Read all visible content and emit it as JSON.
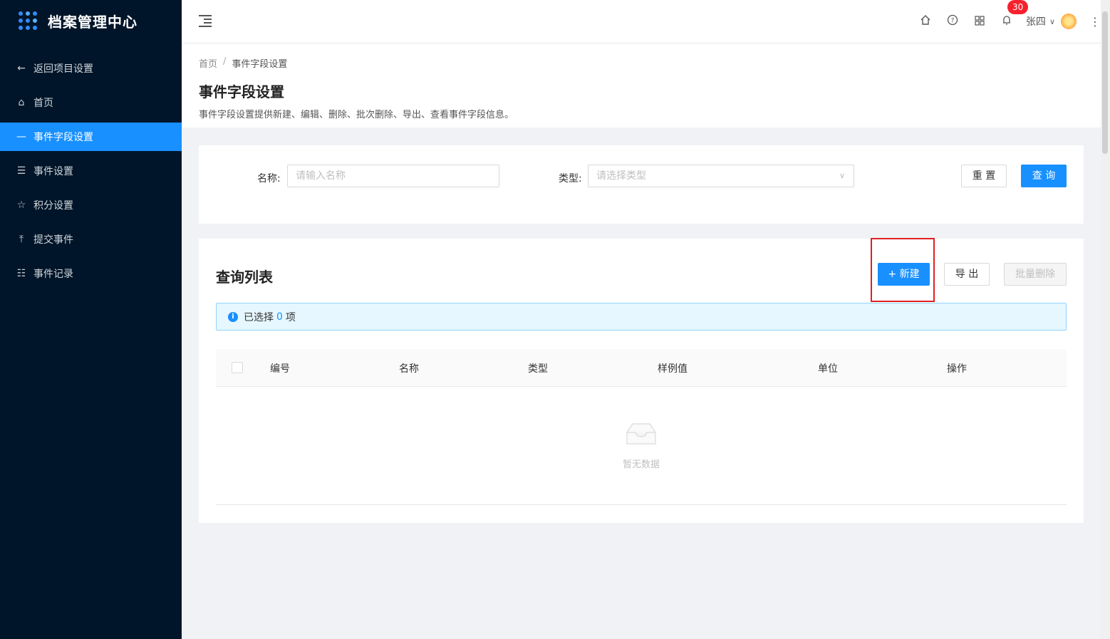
{
  "app": {
    "title": "档案管理中心"
  },
  "sidebar": {
    "items": [
      {
        "label": "返回项目设置",
        "icon": "arrow-left-icon",
        "glyph": "←"
      },
      {
        "label": "首页",
        "icon": "home-icon",
        "glyph": "⌂"
      },
      {
        "label": "事件字段设置",
        "icon": "minus-icon",
        "glyph": "—"
      },
      {
        "label": "事件设置",
        "icon": "menu-icon",
        "glyph": "☰"
      },
      {
        "label": "积分设置",
        "icon": "star-icon",
        "glyph": "☆"
      },
      {
        "label": "提交事件",
        "icon": "upload-icon",
        "glyph": "⤒"
      },
      {
        "label": "事件记录",
        "icon": "list-icon",
        "glyph": "☷"
      }
    ],
    "active_index": 2
  },
  "header": {
    "notification_count": "30",
    "user_name": "张四"
  },
  "breadcrumb": {
    "home": "首页",
    "separator": "/",
    "current": "事件字段设置"
  },
  "page": {
    "title": "事件字段设置",
    "description": "事件字段设置提供新建、编辑、删除、批次删除、导出、查看事件字段信息。"
  },
  "query": {
    "name_label": "名称:",
    "name_placeholder": "请输入名称",
    "type_label": "类型:",
    "type_placeholder": "请选择类型",
    "reset_label": "重 置",
    "search_label": "查 询"
  },
  "list": {
    "title": "查询列表",
    "new_label": "+ 新建",
    "export_label": "导 出",
    "batch_delete_label": "批量删除",
    "selected_prefix": "已选择",
    "selected_count": "0",
    "selected_suffix": "项",
    "columns": [
      "编号",
      "名称",
      "类型",
      "样例值",
      "单位",
      "操作"
    ],
    "empty_text": "暂无数据"
  },
  "colors": {
    "sidebar_bg": "#001529",
    "accent": "#1890ff",
    "highlight": "#e02020",
    "badge": "#f5222d"
  }
}
